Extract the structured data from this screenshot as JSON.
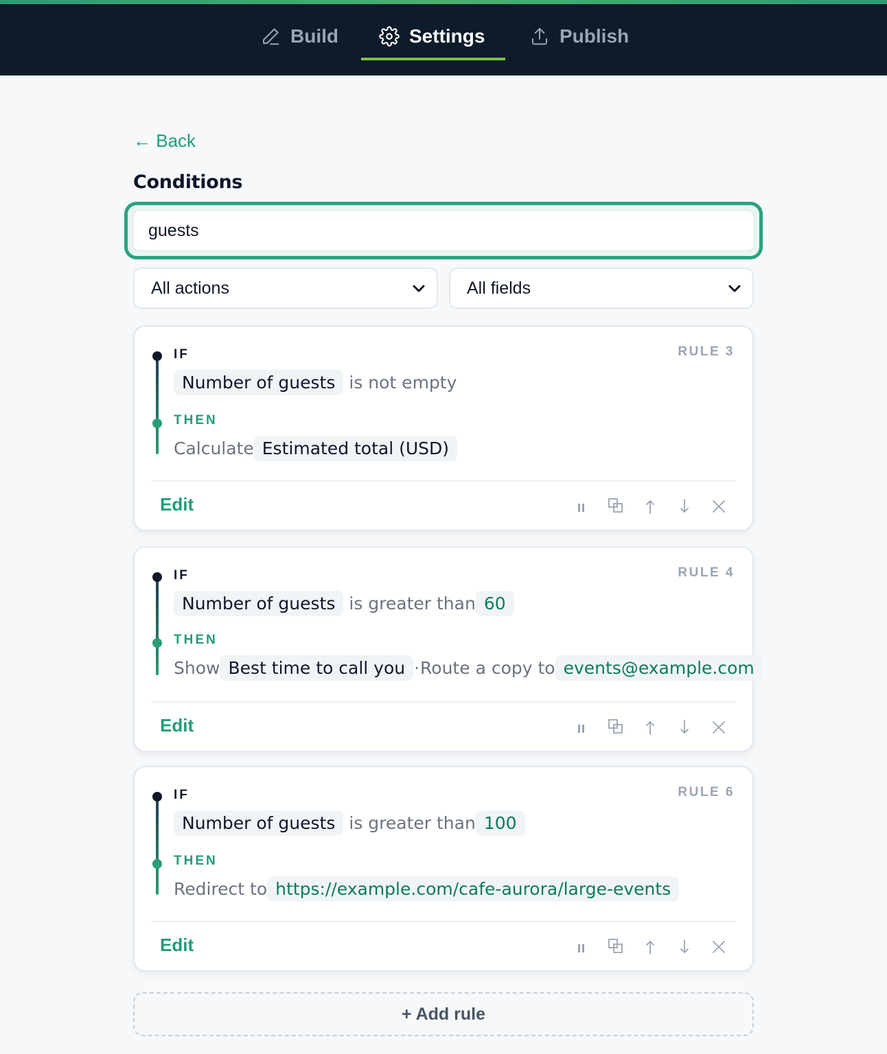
{
  "nav": {
    "tabs": [
      {
        "label": "Build",
        "icon": "pencil-icon"
      },
      {
        "label": "Settings",
        "icon": "gear-icon"
      },
      {
        "label": "Publish",
        "icon": "upload-icon"
      }
    ],
    "active_tab": "Settings"
  },
  "main": {
    "back_label": "← Back",
    "section_title": "Conditions",
    "search_value": "guests",
    "filter_actions": "All actions",
    "filter_fields": "All fields"
  },
  "labels": {
    "if": "IF",
    "then": "THEN",
    "edit": "Edit"
  },
  "rules": [
    {
      "rule_label": "RULE 3",
      "field": "Number of guests",
      "operator": "is not empty",
      "value": "",
      "action_verb": "Calculate",
      "action_target": "Estimated total (USD)"
    },
    {
      "rule_label": "RULE 4",
      "field": "Number of guests",
      "operator": "is greater than",
      "value": "60",
      "action_verb": "Show",
      "action_target": "Best time to call you",
      "separator": "·",
      "action2_verb": "Route a copy to",
      "action2_target": "events@example.com"
    },
    {
      "rule_label": "RULE 6",
      "field": "Number of guests",
      "operator": "is greater than",
      "value": "100",
      "action_verb": "Redirect to",
      "action_target": "https://example.com/cafe-aurora/large-events"
    }
  ],
  "add_rule_label": "+ Add rule",
  "colors": {
    "accent": "#1f9d7a",
    "nav_bg": "#0d1b2a",
    "tab_underline": "#7cc242"
  }
}
